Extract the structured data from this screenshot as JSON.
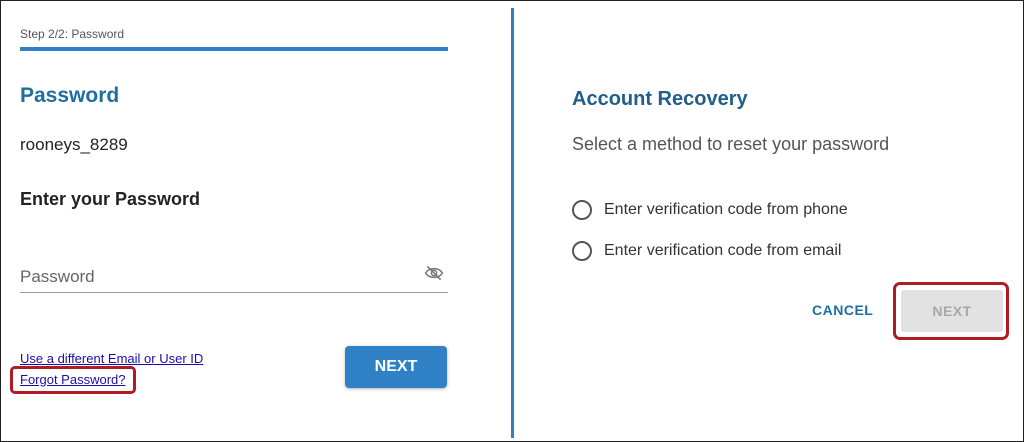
{
  "login": {
    "step_label": "Step 2/2: Password",
    "title": "Password",
    "username": "rooneys_8289",
    "enter_heading": "Enter your Password",
    "password_placeholder": "Password",
    "different_account_link": "Use a different Email or User ID",
    "forgot_link": "Forgot Password?",
    "next_label": "NEXT",
    "toggle_icon": "eye-off-icon"
  },
  "recovery": {
    "title": "Account Recovery",
    "subtitle": "Select a method to reset your password",
    "options": [
      {
        "label": "Enter verification code from phone"
      },
      {
        "label": "Enter verification code from email"
      }
    ],
    "cancel_label": "CANCEL",
    "next_label": "NEXT",
    "next_disabled": true
  },
  "colors": {
    "accent": "#2f80c4",
    "heading": "#1f6ea0",
    "highlight": "#b01c24",
    "link": "#1a0dab",
    "disabled_bg": "#e2e2e2"
  }
}
